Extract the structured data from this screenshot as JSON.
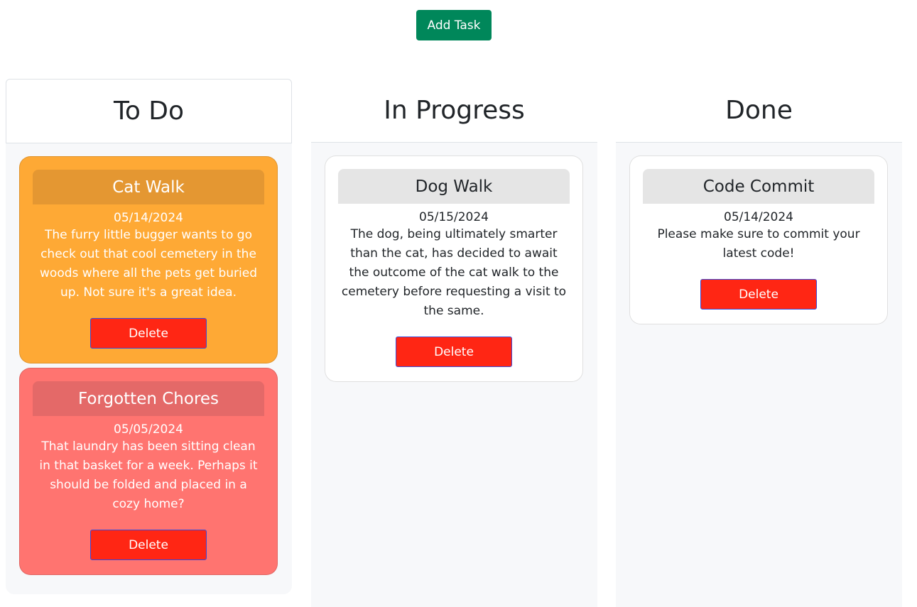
{
  "toolbar": {
    "add_task_label": "Add Task"
  },
  "colors": {
    "add_task": "#00875a",
    "delete": "#ff2614",
    "card_orange": "#fea935",
    "card_red": "#ff7470",
    "card_white": "#ffffff"
  },
  "lanes": [
    {
      "title": "To Do",
      "cards": [
        {
          "title": "Cat Walk",
          "date": "05/14/2024",
          "description": "The furry little bugger wants to go check out that cool cemetery in the woods where all the pets get buried up. Not sure it's a great idea.",
          "delete_label": "Delete",
          "status_color": "orange"
        },
        {
          "title": "Forgotten Chores",
          "date": "05/05/2024",
          "description": "That laundry has been sitting clean in that basket for a week. Perhaps it should be folded and placed in a cozy home?",
          "delete_label": "Delete",
          "status_color": "red"
        }
      ]
    },
    {
      "title": "In Progress",
      "cards": [
        {
          "title": "Dog Walk",
          "date": "05/15/2024",
          "description": "The dog, being ultimately smarter than the cat, has decided to await the outcome of the cat walk to the cemetery before requesting a visit to the same.",
          "delete_label": "Delete",
          "status_color": "white"
        }
      ]
    },
    {
      "title": "Done",
      "cards": [
        {
          "title": "Code Commit",
          "date": "05/14/2024",
          "description": "Please make sure to commit your latest code!",
          "delete_label": "Delete",
          "status_color": "white"
        }
      ]
    }
  ]
}
